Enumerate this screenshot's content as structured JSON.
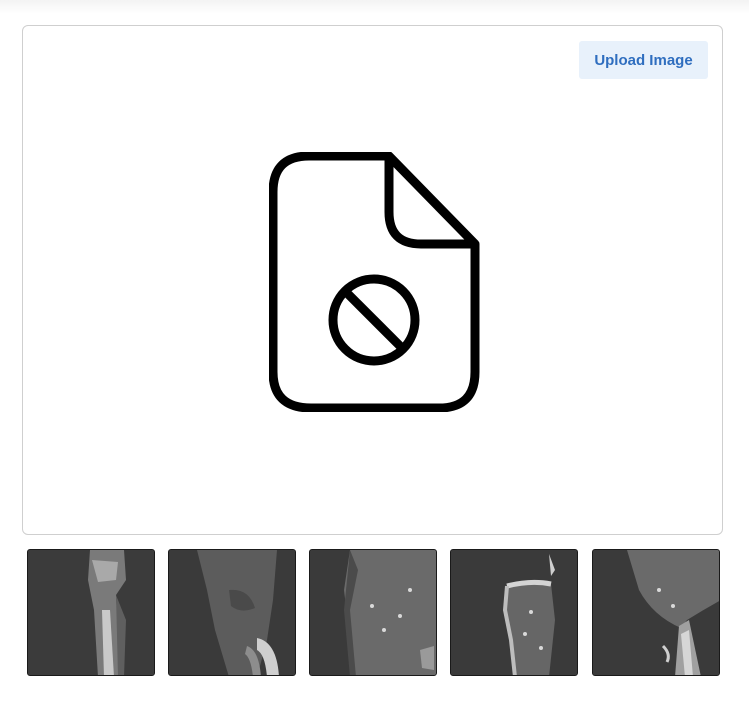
{
  "viewer": {
    "upload_label": "Upload Image",
    "placeholder_icon": "file-blocked-icon"
  },
  "thumbnails": [
    {
      "name": "thumbnail-1",
      "icon": "ct-slice-image"
    },
    {
      "name": "thumbnail-2",
      "icon": "ct-slice-image"
    },
    {
      "name": "thumbnail-3",
      "icon": "ct-slice-image"
    },
    {
      "name": "thumbnail-4",
      "icon": "ct-slice-image"
    },
    {
      "name": "thumbnail-5",
      "icon": "ct-slice-image"
    }
  ],
  "colors": {
    "accent": "#2f6ebf",
    "button_bg": "#e8f1fb",
    "border": "#cfcfcf"
  }
}
